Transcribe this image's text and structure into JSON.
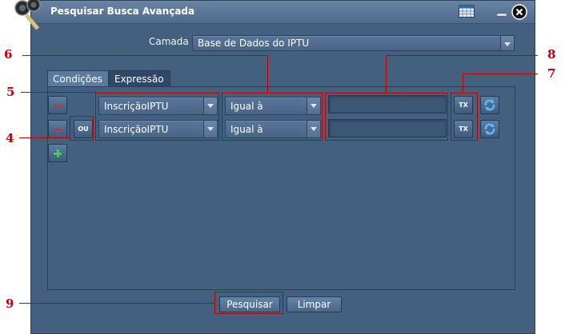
{
  "window": {
    "title": "Pesquisar Busca Avançada"
  },
  "camada": {
    "label": "Camada",
    "selected": "Base de Dados do IPTU"
  },
  "tabs": [
    {
      "label": "Condições",
      "active": true
    },
    {
      "label": "Expressão",
      "active": false
    }
  ],
  "rows": [
    {
      "field": "InscriçãoIPTU",
      "operator": "Igual à",
      "value": "",
      "tx": "TX"
    },
    {
      "connector": "OU",
      "field": "InscriçãoIPTU",
      "operator": "Igual à",
      "value": "",
      "tx": "TX"
    }
  ],
  "buttons": {
    "search": "Pesquisar",
    "clear": "Limpar"
  },
  "annotations": [
    "4",
    "5",
    "6",
    "7",
    "8",
    "9"
  ],
  "colors": {
    "window_bg": "#44607f",
    "annotation": "#c00000",
    "remove_icon": "#e02a2a",
    "add_icon": "#3fd23f"
  }
}
